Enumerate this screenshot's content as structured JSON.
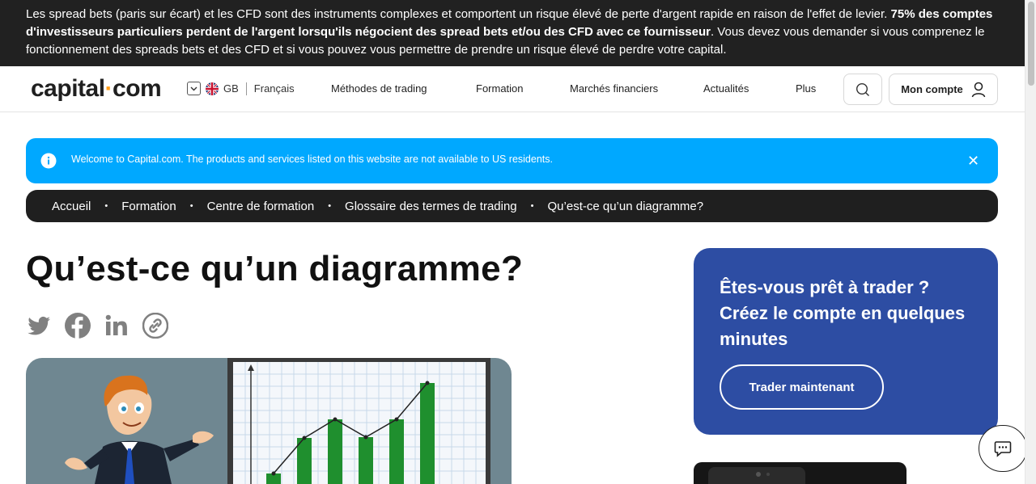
{
  "risk_banner": {
    "text_start": "Les spread bets (paris sur écart) et les CFD sont des instruments complexes et comportent un risque élevé de perte d'argent rapide en raison de l'effet de levier. ",
    "text_bold": "75% des comptes d'investisseurs particuliers perdent de l'argent lorsqu'ils négocient des spread bets et/ou des CFD avec ce fournisseur",
    "text_end": ". Vous devez vous demander si vous comprenez le fonctionnement des spreads bets et des CFD et si vous pouvez vous permettre de prendre un risque élevé de perdre votre capital."
  },
  "header": {
    "logo_part1": "capital",
    "logo_dot": "·",
    "logo_part2": "com",
    "region": "GB",
    "language": "Français",
    "nav": [
      "Méthodes de trading",
      "Formation",
      "Marchés financiers",
      "Actualités",
      "Plus"
    ],
    "account_label": "Mon compte"
  },
  "alert": {
    "message": "Welcome to Capital.com. The products and services listed on this website are not available to US residents.",
    "close": "✕"
  },
  "breadcrumb": [
    "Accueil",
    "Formation",
    "Centre de formation",
    "Glossaire des termes de trading",
    "Qu’est-ce qu’un diagramme?"
  ],
  "breadcrumb_separator": "•",
  "page_title": "Qu’est-ce qu’un diagramme?",
  "share_icons": [
    "twitter-icon",
    "facebook-icon",
    "linkedin-icon",
    "copy-link-icon"
  ],
  "cta": {
    "title": "Êtes-vous prêt à trader ? Créez le compte en quelques minutes",
    "button": "Trader maintenant"
  },
  "colors": {
    "banner_bg": "#212121",
    "alert_bg": "#00a8ff",
    "cta_bg": "#2d4da3",
    "logo_dot": "#ff9e1b",
    "chart_bar": "#1f8f2e"
  }
}
